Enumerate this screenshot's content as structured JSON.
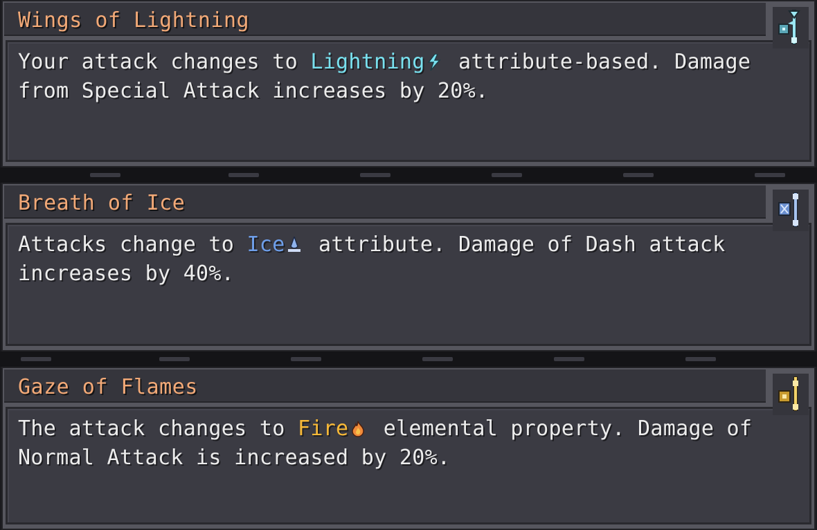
{
  "colors": {
    "title": "#f2a977",
    "text": "#ececec",
    "lightning": "#79e1ef",
    "ice": "#6e9ee9",
    "fire": "#f7b938",
    "panel": "#3b3b43",
    "frame": "#56565e"
  },
  "cards": [
    {
      "title": "Wings of Lightning",
      "desc_before": "Your attack changes to ",
      "keyword": "Lightning",
      "element_icon": "lightning-bolt-icon",
      "desc_after": " attribute-based. Damage from Special Attack increases by 20%.",
      "rune_icon": "lightning-wing-rune-icon"
    },
    {
      "title": "Breath of Ice",
      "desc_before": "Attacks change to ",
      "keyword": "Ice",
      "element_icon": "ice-drop-icon",
      "desc_after": " attribute. Damage of Dash attack increases by 40%.",
      "rune_icon": "ice-breath-rune-icon"
    },
    {
      "title": "Gaze of Flames",
      "desc_before": "The attack changes to ",
      "keyword": "Fire",
      "element_icon": "fire-flame-icon",
      "desc_after": " elemental property. Damage of Normal Attack is increased by 20%.",
      "rune_icon": "flame-gaze-rune-icon"
    }
  ]
}
